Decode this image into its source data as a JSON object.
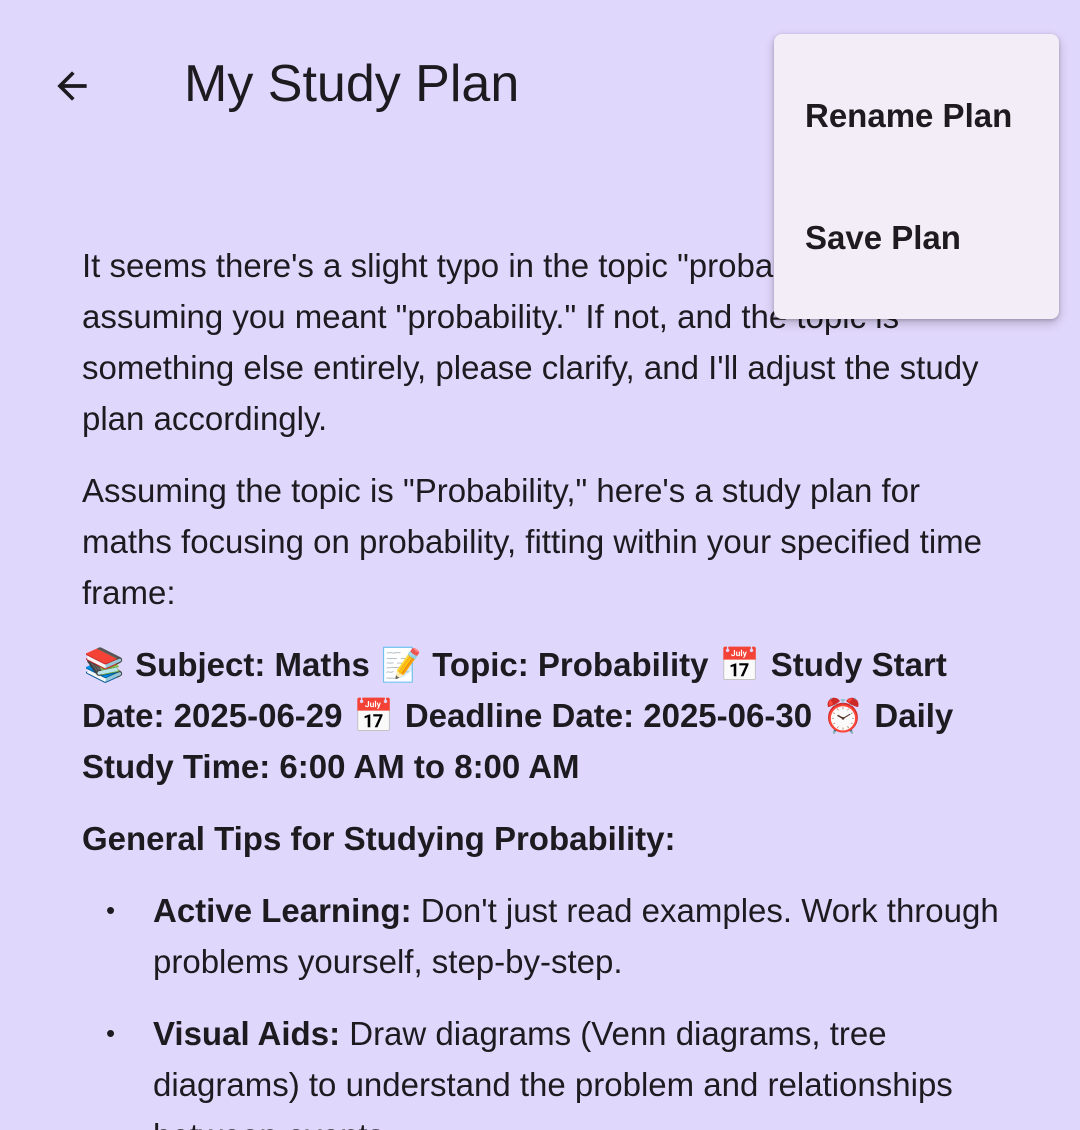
{
  "app_bar": {
    "title": "My Study Plan",
    "back_icon": "arrow-left-icon"
  },
  "menu": {
    "items": [
      {
        "label": "Rename Plan"
      },
      {
        "label": "Save Plan"
      }
    ]
  },
  "content": {
    "intro": "It seems there's a slight typo in the topic \"probability.\" I'm assuming you meant \"probability.\" If not, and the topic is something else entirely, please clarify, and I'll adjust the study plan accordingly.",
    "assumption": "Assuming the topic is \"Probability,\" here's a study plan for maths focusing on probability, fitting within your specified time frame:",
    "summary": {
      "subject_emoji": "📚",
      "subject": "Subject: Maths",
      "topic_emoji": "📝",
      "topic": "Topic: Probability",
      "start_emoji": "📅",
      "start": "Study Start Date: 2025-06-29",
      "deadline_emoji": "📅",
      "deadline": "Deadline Date: 2025-06-30",
      "time_emoji": "⏰",
      "daily_time": "Daily Study Time: 6:00 AM to 8:00 AM"
    },
    "tips_heading": "General Tips for Studying Probability:",
    "tips": [
      {
        "title": "Active Learning:",
        "text": " Don't just read examples.  Work through problems yourself, step-by-step."
      },
      {
        "title": "Visual Aids:",
        "text": " Draw diagrams (Venn diagrams, tree diagrams) to understand the problem and relationships between events."
      }
    ],
    "bullet": "•"
  }
}
